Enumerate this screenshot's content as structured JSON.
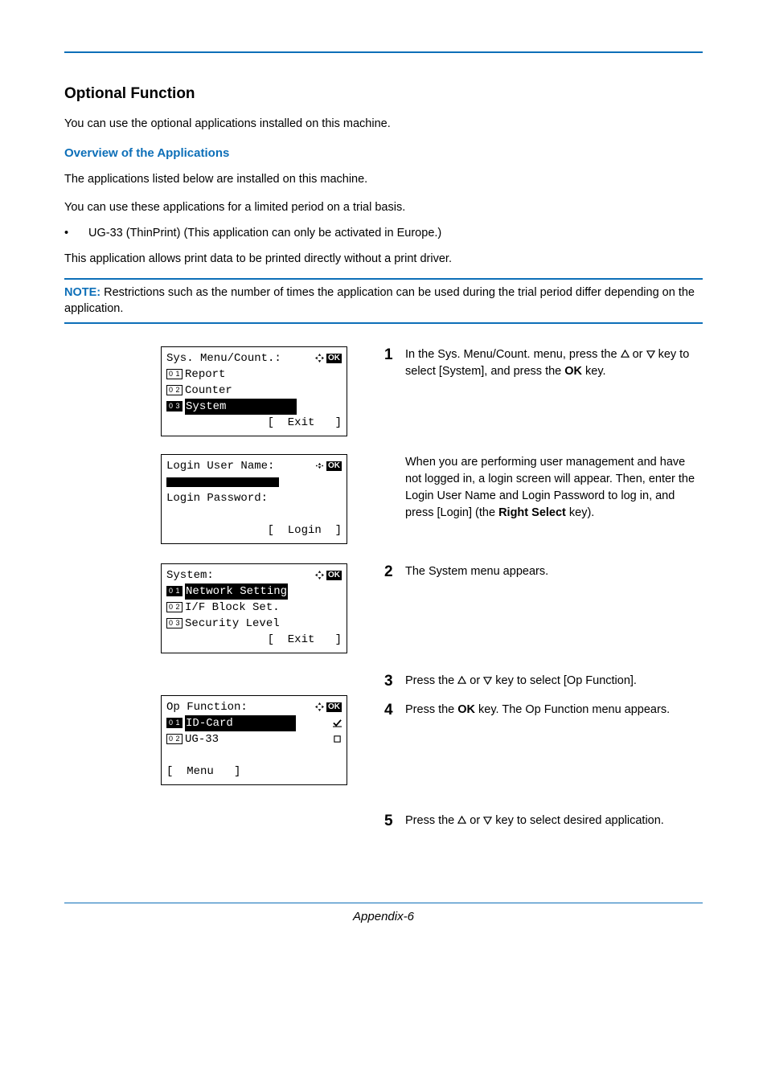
{
  "title": "Optional Function",
  "intro1": "You can use the optional applications installed on this machine.",
  "overview_heading": "Overview of the Applications",
  "intro2": "The applications listed below are installed on this machine.",
  "intro3": "You can use these applications for a limited period on a trial basis.",
  "bullet1": "UG-33 (ThinPrint) (This application can only be activated in Europe.)",
  "intro4": "This application allows print data to be printed directly without a print driver.",
  "note_label": "NOTE:",
  "note_text": " Restrictions such as the number of times the application can be used during the trial period differ depending on the application.",
  "lcd1": {
    "title": "Sys. Menu/Count.:",
    "i1": "Report",
    "i2": "Counter",
    "i3": "System",
    "soft": "[  Exit   ]"
  },
  "lcd2": {
    "l1": "Login User Name:",
    "l2": "Login Password:",
    "soft": "[  Login  ]"
  },
  "lcd3": {
    "title": "System:",
    "i1": "Network Setting",
    "i2": "I/F Block Set.",
    "i3": "Security Level",
    "soft": "[  Exit   ]"
  },
  "lcd4": {
    "title": "Op Function:",
    "i1": "ID-Card",
    "i2": "UG-33",
    "soft": "[  Menu   ]"
  },
  "steps": {
    "s1a": "In the Sys. Menu/Count. menu, press the ",
    "s1b": " or ",
    "s1c": " key to select [System], and press the ",
    "s1ok": "OK",
    "s1d": " key.",
    "s1x": "When you are performing user management and have not logged in, a login screen will appear. Then, enter the Login User Name and Login Password to log in, and press [Login] (the ",
    "s1xb": "Right Select",
    "s1xc": " key).",
    "s2": "The System menu appears.",
    "s3a": "Press the ",
    "s3b": " or ",
    "s3c": " key to select [Op Function].",
    "s4a": "Press the ",
    "s4ok": "OK",
    "s4b": " key. The Op Function menu appears.",
    "s5a": "Press the ",
    "s5b": " or ",
    "s5c": " key to select desired application."
  },
  "footer": "Appendix-6"
}
